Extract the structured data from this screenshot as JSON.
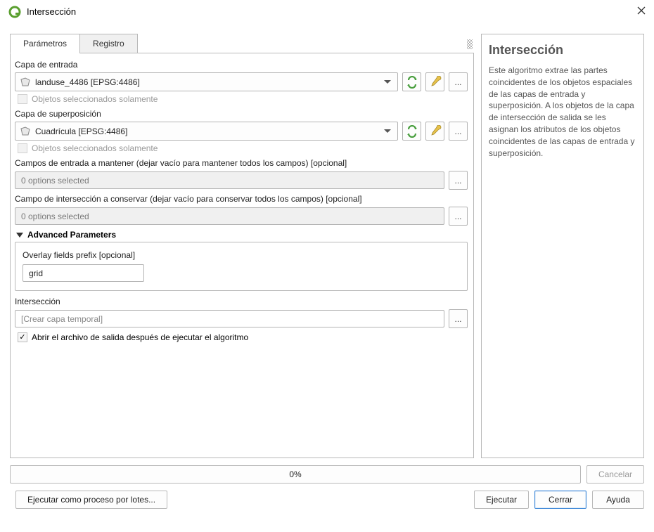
{
  "window": {
    "title": "Intersección"
  },
  "tabs": {
    "param": "Parámetros",
    "log": "Registro"
  },
  "param": {
    "inputLayerLabel": "Capa de entrada",
    "inputLayerValue": "landuse_4486 [EPSG:4486]",
    "selectedOnly": "Objetos seleccionados solamente",
    "overlayLayerLabel": "Capa de superposición",
    "overlayLayerValue": "Cuadrícula [EPSG:4486]",
    "inputFieldsLabel": "Campos de entrada a mantener (dejar vacío para mantener todos los campos) [opcional]",
    "inputFieldsValue": "0 options selected",
    "overlayFieldsLabel": "Campo de intersección a conservar (dejar vacío para conservar todos los campos) [opcional]",
    "overlayFieldsValue": "0 options selected",
    "advancedTitle": "Advanced Parameters",
    "overlayPrefixLabel": "Overlay fields prefix [opcional]",
    "overlayPrefixValue": "grid",
    "outputLabel": "Intersección",
    "outputPlaceholder": "[Crear capa temporal]",
    "openAfter": "Abrir el archivo de salida después de ejecutar el algoritmo",
    "ellipsis": "…",
    "optEllipsis": "..."
  },
  "help": {
    "title": "Intersección",
    "body": "Este algoritmo extrae las partes coincidentes de los objetos espaciales de las capas de entrada y superposición. A los objetos de la capa de intersección de salida se les asignan los atributos de los objetos coincidentes de las capas de entrada y superposición."
  },
  "footer": {
    "progress": "0%",
    "cancel": "Cancelar",
    "batch": "Ejecutar como proceso por lotes...",
    "run": "Ejecutar",
    "close": "Cerrar",
    "helpBtn": "Ayuda"
  }
}
